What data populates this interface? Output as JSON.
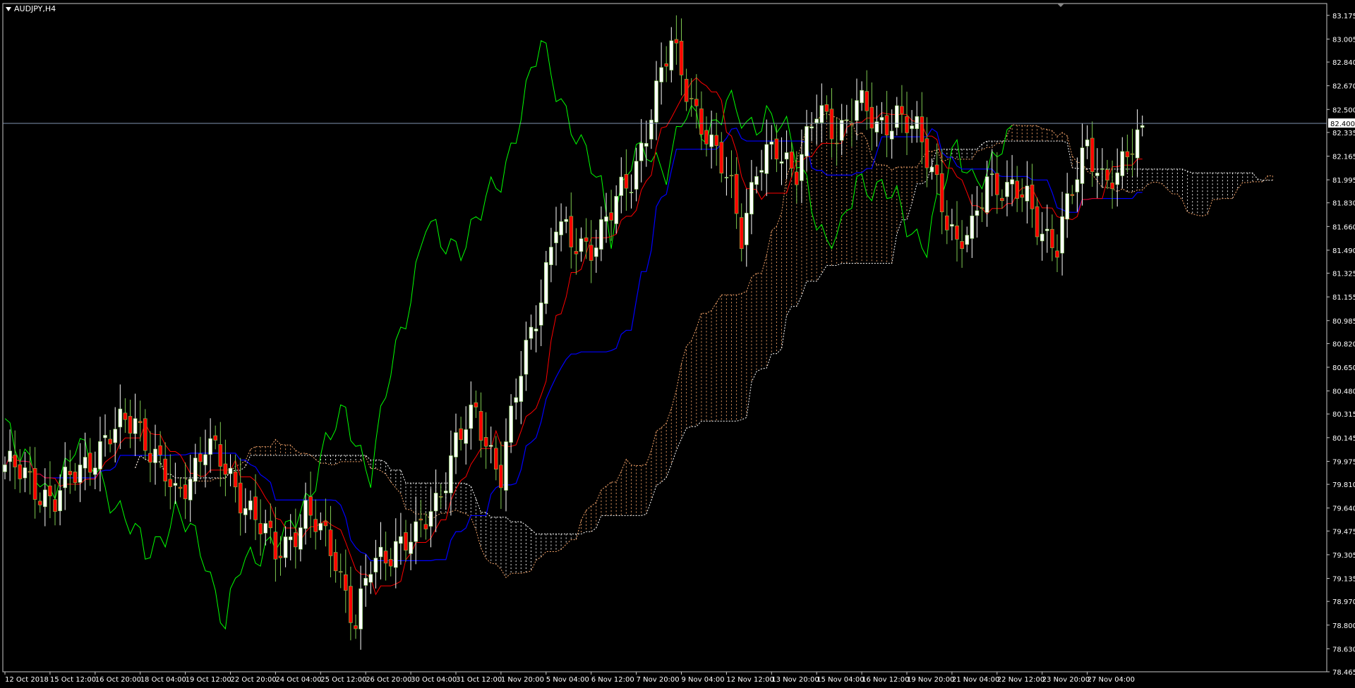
{
  "window": {
    "symbol_label": "AUDJPY,H4"
  },
  "colors": {
    "background": "#000000",
    "frame": "#c8c8c8",
    "text": "#ffffff",
    "bull": "#ffffff",
    "bear": "#ff0000",
    "bull_wick": "#7ec850",
    "tenkan": "#ff0000",
    "kijun": "#0000ff",
    "chikou": "#00ff00",
    "cloud_a": "#f4a46a",
    "cloud_b": "#ffffff",
    "price_line": "#7f95b0"
  },
  "chart_data": {
    "type": "candlestick",
    "instrument": "AUDJPY",
    "timeframe": "H4",
    "current_price": 82.4,
    "current_price_label": "82.400",
    "ylim": [
      78.465,
      83.26
    ],
    "y_ticks": [
      "83.175",
      "83.005",
      "82.840",
      "82.670",
      "82.500",
      "82.335",
      "82.165",
      "81.995",
      "81.830",
      "81.660",
      "81.490",
      "81.325",
      "81.155",
      "80.985",
      "80.820",
      "80.650",
      "80.480",
      "80.315",
      "80.145",
      "79.975",
      "79.810",
      "79.640",
      "79.475",
      "79.305",
      "79.135",
      "78.970",
      "78.800",
      "78.630",
      "78.465"
    ],
    "x_ticks": [
      "12 Oct 2018",
      "15 Oct 12:00",
      "16 Oct 20:00",
      "18 Oct 04:00",
      "19 Oct 12:00",
      "22 Oct 20:00",
      "24 Oct 04:00",
      "25 Oct 12:00",
      "26 Oct 20:00",
      "30 Oct 04:00",
      "31 Oct 12:00",
      "1 Nov 20:00",
      "5 Nov 04:00",
      "6 Nov 12:00",
      "7 Nov 20:00",
      "9 Nov 04:00",
      "12 Nov 12:00",
      "13 Nov 20:00",
      "15 Nov 04:00",
      "16 Nov 12:00",
      "19 Nov 20:00",
      "21 Nov 04:00",
      "22 Nov 12:00",
      "23 Nov 20:00",
      "27 Nov 04:00"
    ],
    "anchors": [
      [
        0,
        79.95
      ],
      [
        10,
        79.7
      ],
      [
        18,
        80.05
      ],
      [
        26,
        80.3
      ],
      [
        34,
        79.7
      ],
      [
        40,
        80.1
      ],
      [
        48,
        79.7
      ],
      [
        54,
        79.3
      ],
      [
        60,
        79.6
      ],
      [
        66,
        79.3
      ],
      [
        70,
        78.8
      ],
      [
        73,
        79.2
      ],
      [
        78,
        79.4
      ],
      [
        82,
        79.4
      ],
      [
        86,
        79.7
      ],
      [
        90,
        80.1
      ],
      [
        94,
        80.3
      ],
      [
        99,
        79.9
      ],
      [
        103,
        80.6
      ],
      [
        107,
        81.2
      ],
      [
        110,
        81.7
      ],
      [
        113,
        81.5
      ],
      [
        117,
        81.55
      ],
      [
        121,
        81.75
      ],
      [
        125,
        82.0
      ],
      [
        129,
        82.5
      ],
      [
        133,
        82.95
      ],
      [
        137,
        82.6
      ],
      [
        141,
        82.2
      ],
      [
        145,
        81.95
      ],
      [
        147,
        81.65
      ],
      [
        150,
        82.05
      ],
      [
        154,
        82.2
      ],
      [
        158,
        82.1
      ],
      [
        162,
        82.45
      ],
      [
        166,
        82.35
      ],
      [
        170,
        82.55
      ],
      [
        174,
        82.35
      ],
      [
        178,
        82.5
      ],
      [
        182,
        82.3
      ],
      [
        186,
        82.0
      ],
      [
        190,
        81.5
      ],
      [
        193,
        81.6
      ],
      [
        196,
        82.05
      ],
      [
        200,
        81.9
      ],
      [
        204,
        81.85
      ],
      [
        208,
        81.6
      ],
      [
        210,
        81.5
      ],
      [
        213,
        81.9
      ],
      [
        216,
        82.3
      ],
      [
        219,
        82.0
      ],
      [
        222,
        81.95
      ],
      [
        224,
        82.2
      ],
      [
        227,
        82.4
      ]
    ],
    "cloud_shift": 26,
    "tenkan_period": 9,
    "kijun_period": 26,
    "senkou_b_period": 52
  }
}
